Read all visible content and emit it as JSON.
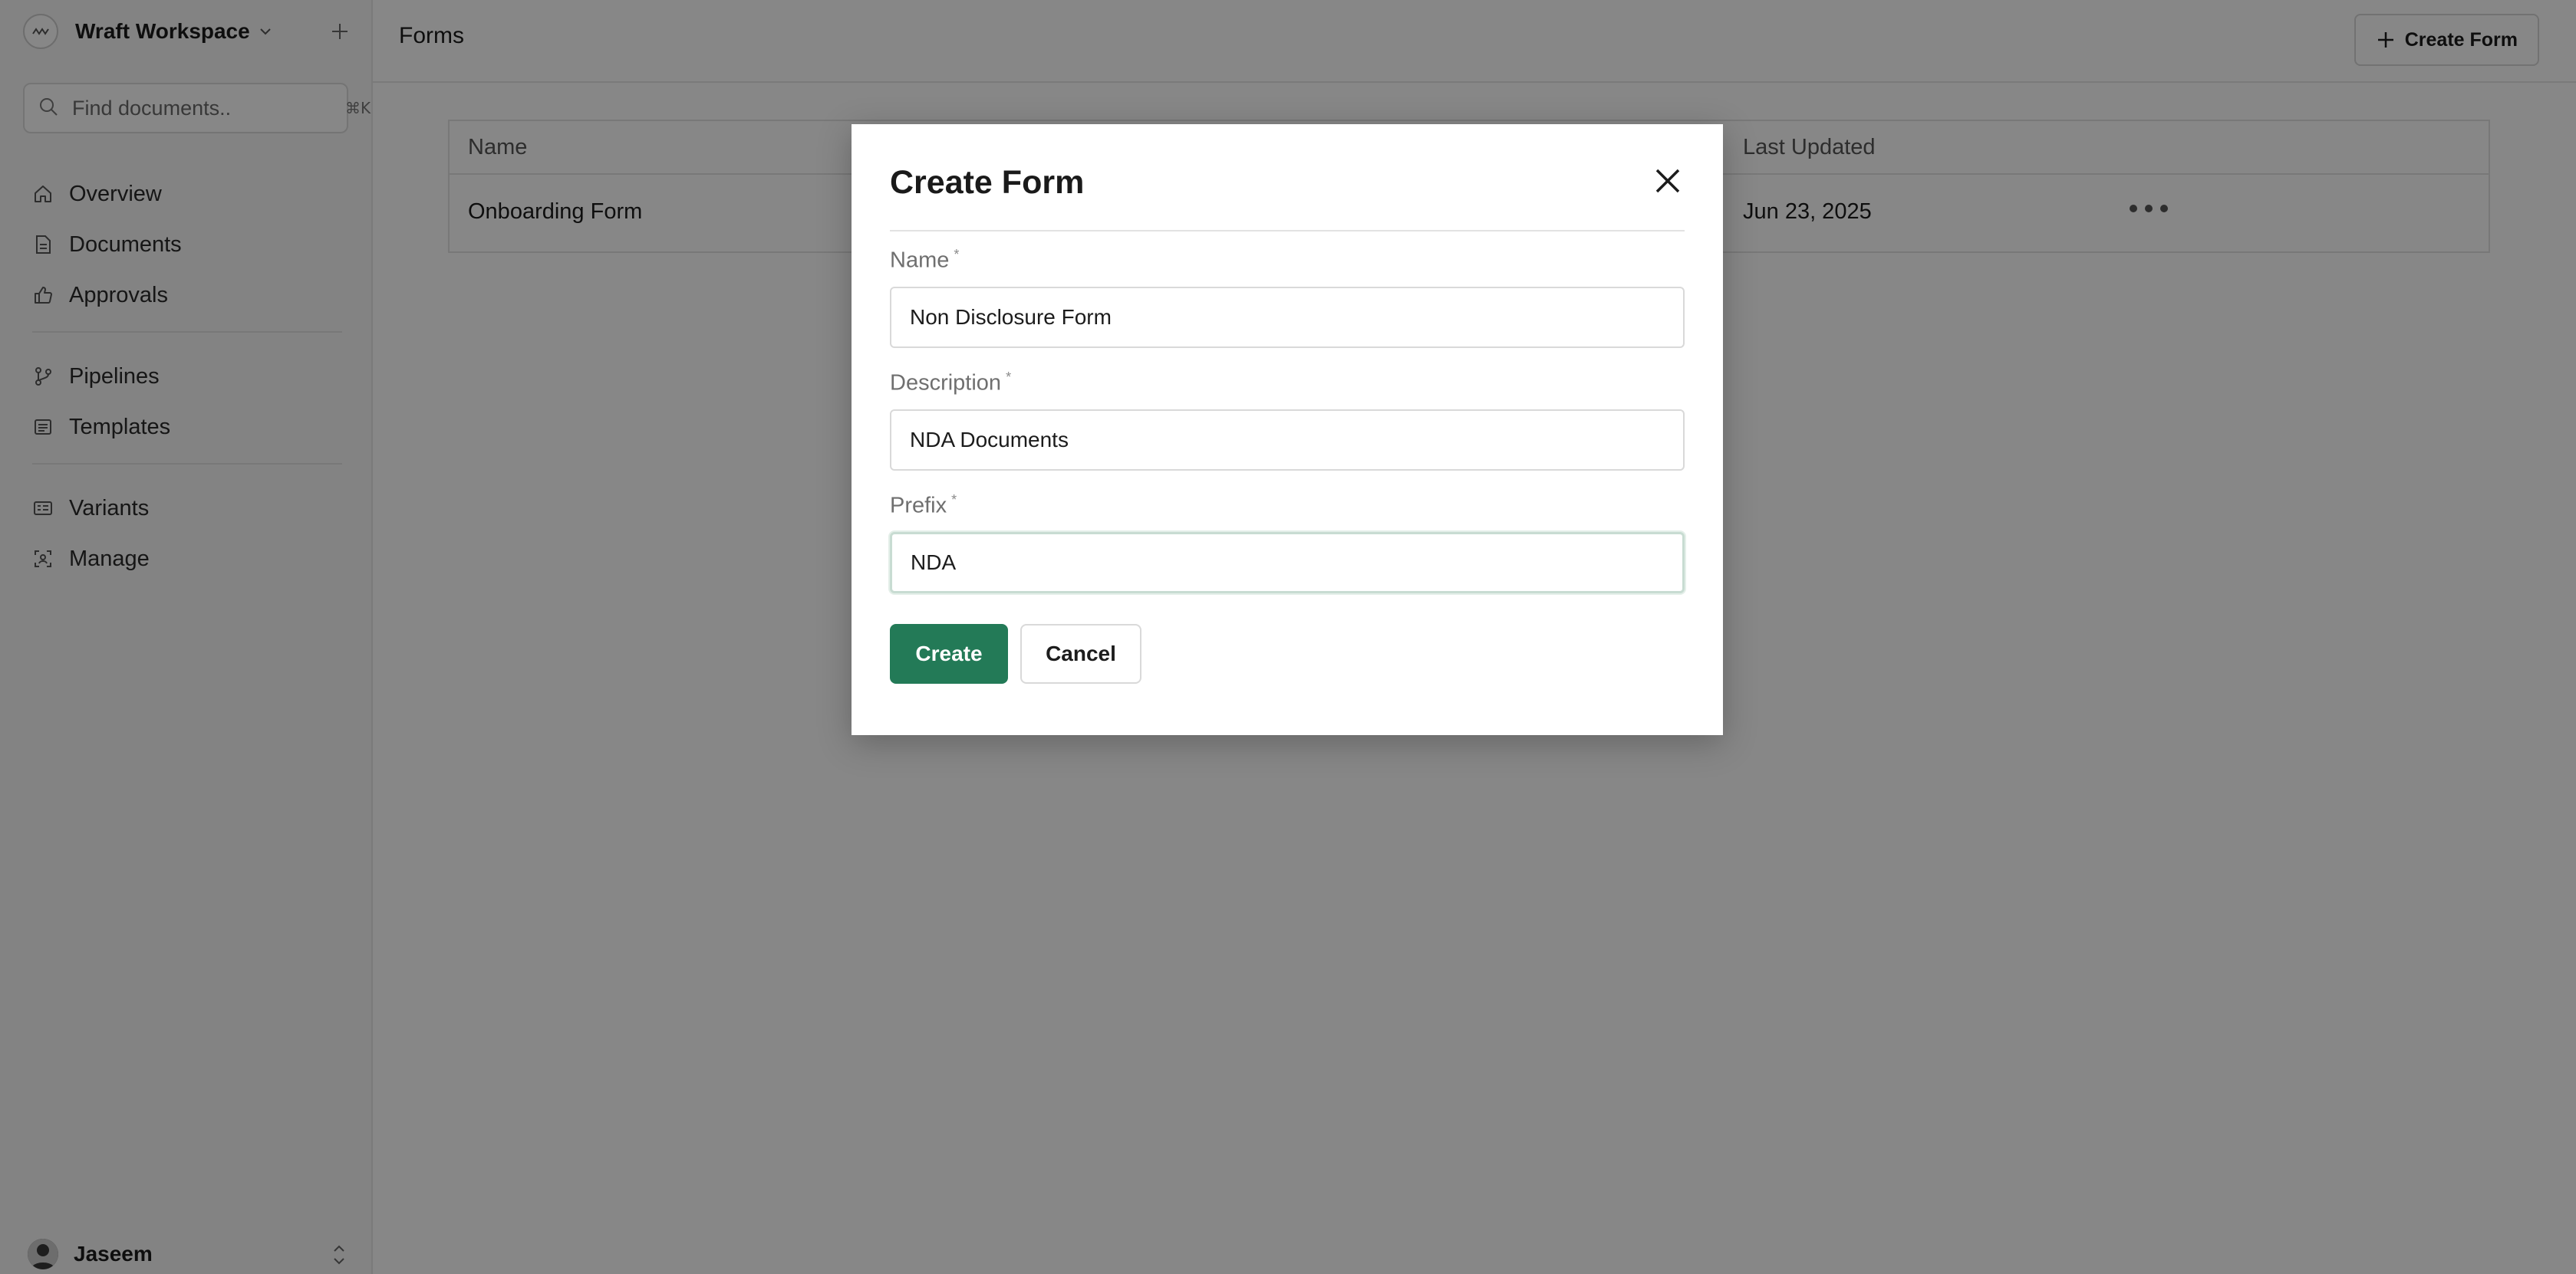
{
  "sidebar": {
    "workspace_name": "Wraft Workspace",
    "search_placeholder": "Find documents..",
    "search_shortcut": "⌘K",
    "nav_primary": [
      {
        "label": "Overview",
        "icon": "home-icon"
      },
      {
        "label": "Documents",
        "icon": "document-icon"
      },
      {
        "label": "Approvals",
        "icon": "thumbs-up-icon"
      }
    ],
    "nav_secondary": [
      {
        "label": "Pipelines",
        "icon": "git-branch-icon"
      },
      {
        "label": "Templates",
        "icon": "template-icon"
      }
    ],
    "nav_tertiary": [
      {
        "label": "Variants",
        "icon": "variants-icon"
      },
      {
        "label": "Manage",
        "icon": "manage-icon"
      }
    ],
    "user_name": "Jaseem"
  },
  "header": {
    "title": "Forms",
    "create_button_label": "Create Form"
  },
  "table": {
    "columns": [
      "Name",
      "Last Updated"
    ],
    "rows": [
      {
        "name": "Onboarding Form",
        "last_updated": "Jun 23, 2025"
      }
    ]
  },
  "modal": {
    "title": "Create Form",
    "fields": {
      "name": {
        "label": "Name",
        "required_mark": "*",
        "value": "Non Disclosure Form"
      },
      "description": {
        "label": "Description",
        "required_mark": "*",
        "value": "NDA Documents"
      },
      "prefix": {
        "label": "Prefix",
        "required_mark": "*",
        "value": "NDA"
      }
    },
    "create_label": "Create",
    "cancel_label": "Cancel"
  },
  "colors": {
    "primary_button": "#237a57",
    "overlay": "rgba(0,0,0,0.47)",
    "sidebar_bg": "#f7f7f7"
  }
}
